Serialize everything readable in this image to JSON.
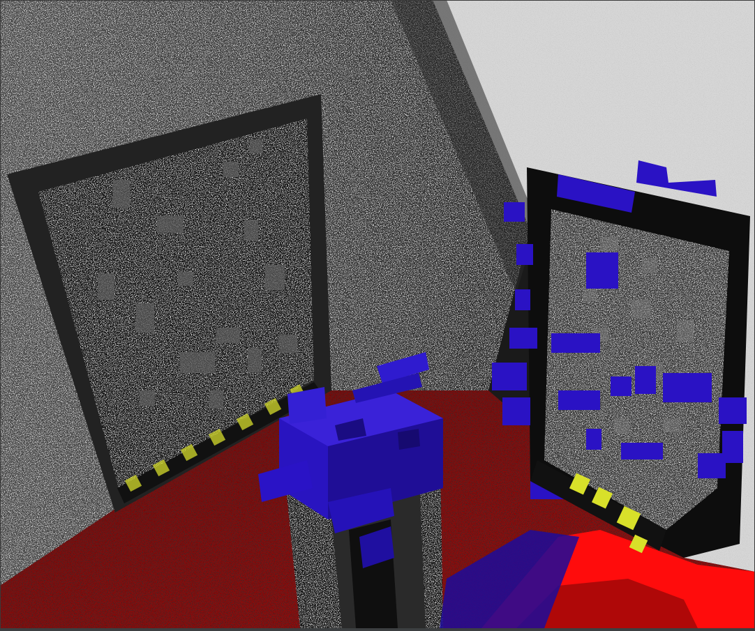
{
  "scene": {
    "description_hidden": "",
    "colors": {
      "wall_left": "#3a3a3a",
      "wall_right": "#d9d9d9",
      "floor": "#8a0c0c",
      "floor_bright": "#ff0a0a",
      "frame_dark": "#1c1c1c",
      "voxel_blue": "#2b12c8",
      "voxel_yellow": "#d8e02a",
      "screen_gray": "#4a4a4a",
      "background": "#2b2b2b"
    }
  }
}
